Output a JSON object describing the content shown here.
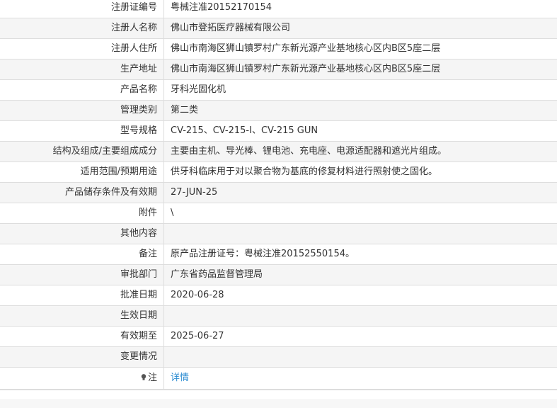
{
  "rows": [
    {
      "label": "注册证编号",
      "value": "粤械注准20152170154"
    },
    {
      "label": "注册人名称",
      "value": "佛山市登拓医疗器械有限公司"
    },
    {
      "label": "注册人住所",
      "value": "佛山市南海区狮山镇罗村广东新光源产业基地核心区内B区5座二层"
    },
    {
      "label": "生产地址",
      "value": "佛山市南海区狮山镇罗村广东新光源产业基地核心区内B区5座二层"
    },
    {
      "label": "产品名称",
      "value": "牙科光固化机"
    },
    {
      "label": "管理类别",
      "value": "第二类"
    },
    {
      "label": "型号规格",
      "value": "CV-215、CV-215-I、CV-215 GUN"
    },
    {
      "label": "结构及组成/主要组成成分",
      "value": "主要由主机、导光棒、锂电池、充电座、电源适配器和遮光片组成。"
    },
    {
      "label": "适用范围/预期用途",
      "value": "供牙科临床用于对以聚合物为基底的修复材料进行照射使之固化。"
    },
    {
      "label": "产品储存条件及有效期",
      "value": "27-JUN-25"
    },
    {
      "label": "附件",
      "value": "\\"
    },
    {
      "label": "其他内容",
      "value": ""
    },
    {
      "label": "备注",
      "value": "原产品注册证号：粤械注准20152550154。"
    },
    {
      "label": "审批部门",
      "value": "广东省药品监督管理局"
    },
    {
      "label": "批准日期",
      "value": "2020-06-28"
    },
    {
      "label": "生效日期",
      "value": ""
    },
    {
      "label": "有效期至",
      "value": "2025-06-27"
    },
    {
      "label": "变更情况",
      "value": ""
    }
  ],
  "note_row": {
    "label": "注",
    "link": "详情",
    "icon": "lightbulb-icon"
  },
  "colors": {
    "link": "#2a8bd1",
    "row_alt": "#f5f5f5",
    "border": "#dddddd"
  }
}
